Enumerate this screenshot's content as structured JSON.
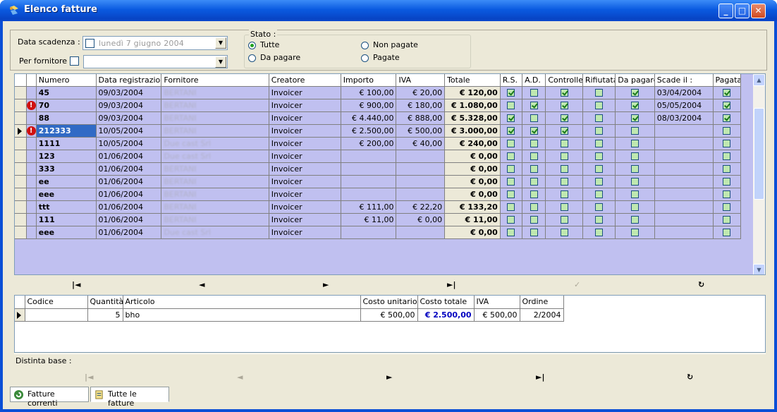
{
  "window": {
    "title": "Elenco fatture"
  },
  "filters": {
    "date_label": "Data scadenza :",
    "date_value": "lunedì   7   giugno   2004",
    "supplier_label": "Per fornitore",
    "supplier_value": "",
    "status_title": "Stato :",
    "status_options": [
      {
        "label": "Tutte",
        "selected": true
      },
      {
        "label": "Non pagate",
        "selected": false
      },
      {
        "label": "Da pagare",
        "selected": false
      },
      {
        "label": "Pagate",
        "selected": false
      }
    ]
  },
  "grid": {
    "columns": [
      "Numero",
      "Data registrazione",
      "Fornitore",
      "Creatore",
      "Importo",
      "IVA",
      "Totale",
      "R.S.",
      "A.D.",
      "Controller",
      "Rifiutata",
      "Da pagare",
      "Scade il :",
      "Pagata"
    ],
    "rows": [
      {
        "warn": false,
        "current": false,
        "numero": "45",
        "data": "09/03/2004",
        "fornitore": "BERTANI",
        "creatore": "Invoicer",
        "importo": "€ 100,00",
        "iva": "€ 20,00",
        "totale": "€ 120,00",
        "rs": true,
        "ad": false,
        "ctrl": true,
        "rif": false,
        "dapagare": true,
        "scade": "03/04/2004",
        "pagata": true
      },
      {
        "warn": true,
        "current": false,
        "numero": "70",
        "data": "09/03/2004",
        "fornitore": "BERTANI",
        "creatore": "Invoicer",
        "importo": "€ 900,00",
        "iva": "€ 180,00",
        "totale": "€ 1.080,00",
        "rs": false,
        "ad": true,
        "ctrl": true,
        "rif": false,
        "dapagare": true,
        "scade": "05/05/2004",
        "pagata": true
      },
      {
        "warn": false,
        "current": false,
        "numero": "88",
        "data": "09/03/2004",
        "fornitore": "BERTANI",
        "creatore": "Invoicer",
        "importo": "€ 4.440,00",
        "iva": "€ 888,00",
        "totale": "€ 5.328,00",
        "rs": true,
        "ad": false,
        "ctrl": true,
        "rif": false,
        "dapagare": true,
        "scade": "08/03/2004",
        "pagata": true
      },
      {
        "warn": true,
        "current": true,
        "numero": "212333",
        "data": "10/05/2004",
        "fornitore": "BERTANI",
        "creatore": "Invoicer",
        "importo": "€ 2.500,00",
        "iva": "€ 500,00",
        "totale": "€ 3.000,00",
        "rs": true,
        "ad": true,
        "ctrl": true,
        "rif": false,
        "dapagare": false,
        "scade": "",
        "pagata": false
      },
      {
        "warn": false,
        "current": false,
        "numero": "1111",
        "data": "10/05/2004",
        "fornitore": "Due cast Srl",
        "creatore": "Invoicer",
        "importo": "€ 200,00",
        "iva": "€ 40,00",
        "totale": "€ 240,00",
        "rs": false,
        "ad": false,
        "ctrl": false,
        "rif": false,
        "dapagare": false,
        "scade": "",
        "pagata": false
      },
      {
        "warn": false,
        "current": false,
        "numero": "123",
        "data": "01/06/2004",
        "fornitore": "Due cast Srl",
        "creatore": "Invoicer",
        "importo": "",
        "iva": "",
        "totale": "€ 0,00",
        "rs": false,
        "ad": false,
        "ctrl": false,
        "rif": false,
        "dapagare": false,
        "scade": "",
        "pagata": false
      },
      {
        "warn": false,
        "current": false,
        "numero": "333",
        "data": "01/06/2004",
        "fornitore": "BERTANI",
        "creatore": "Invoicer",
        "importo": "",
        "iva": "",
        "totale": "€ 0,00",
        "rs": false,
        "ad": false,
        "ctrl": false,
        "rif": false,
        "dapagare": false,
        "scade": "",
        "pagata": false
      },
      {
        "warn": false,
        "current": false,
        "numero": "ee",
        "data": "01/06/2004",
        "fornitore": "BERTANI",
        "creatore": "Invoicer",
        "importo": "",
        "iva": "",
        "totale": "€ 0,00",
        "rs": false,
        "ad": false,
        "ctrl": false,
        "rif": false,
        "dapagare": false,
        "scade": "",
        "pagata": false
      },
      {
        "warn": false,
        "current": false,
        "numero": "eee",
        "data": "01/06/2004",
        "fornitore": "BERTANI",
        "creatore": "Invoicer",
        "importo": "",
        "iva": "",
        "totale": "€ 0,00",
        "rs": false,
        "ad": false,
        "ctrl": false,
        "rif": false,
        "dapagare": false,
        "scade": "",
        "pagata": false
      },
      {
        "warn": false,
        "current": false,
        "numero": "ttt",
        "data": "01/06/2004",
        "fornitore": "BERTANI",
        "creatore": "Invoicer",
        "importo": "€ 111,00",
        "iva": "€ 22,20",
        "totale": "€ 133,20",
        "rs": false,
        "ad": false,
        "ctrl": false,
        "rif": false,
        "dapagare": false,
        "scade": "",
        "pagata": false
      },
      {
        "warn": false,
        "current": false,
        "numero": "111",
        "data": "01/06/2004",
        "fornitore": "BERTANI",
        "creatore": "Invoicer",
        "importo": "€ 11,00",
        "iva": "€ 0,00",
        "totale": "€ 11,00",
        "rs": false,
        "ad": false,
        "ctrl": false,
        "rif": false,
        "dapagare": false,
        "scade": "",
        "pagata": false
      },
      {
        "warn": false,
        "current": false,
        "numero": "eee",
        "data": "01/06/2004",
        "fornitore": "Due cast Srl",
        "creatore": "Invoicer",
        "importo": "",
        "iva": "",
        "totale": "€ 0,00",
        "rs": false,
        "ad": false,
        "ctrl": false,
        "rif": false,
        "dapagare": false,
        "scade": "",
        "pagata": false
      }
    ]
  },
  "nav": {
    "first": "|◄",
    "prev": "◄",
    "next": "►",
    "last": "►|",
    "post": "✓",
    "refresh": "↻"
  },
  "detail": {
    "columns": [
      "Codice",
      "Quantità",
      "Articolo",
      "Costo unitario",
      "Costo totale",
      "IVA",
      "Ordine"
    ],
    "rows": [
      {
        "codice": "",
        "quantita": "5",
        "articolo": "bho",
        "costo_unitario": "€ 500,00",
        "costo_totale": "€ 2.500,00",
        "iva": "€ 500,00",
        "ordine": "2/2004"
      }
    ]
  },
  "distinta": {
    "label": "Distinta base :"
  },
  "tabs": [
    {
      "label": "Fatture correnti",
      "active": false
    },
    {
      "label": "Tutte le fatture",
      "active": true
    }
  ],
  "colors": {
    "grid_bg": "#c0c0f0",
    "title_bar": "#0a5ae0",
    "total_blue": "#0000c0"
  }
}
